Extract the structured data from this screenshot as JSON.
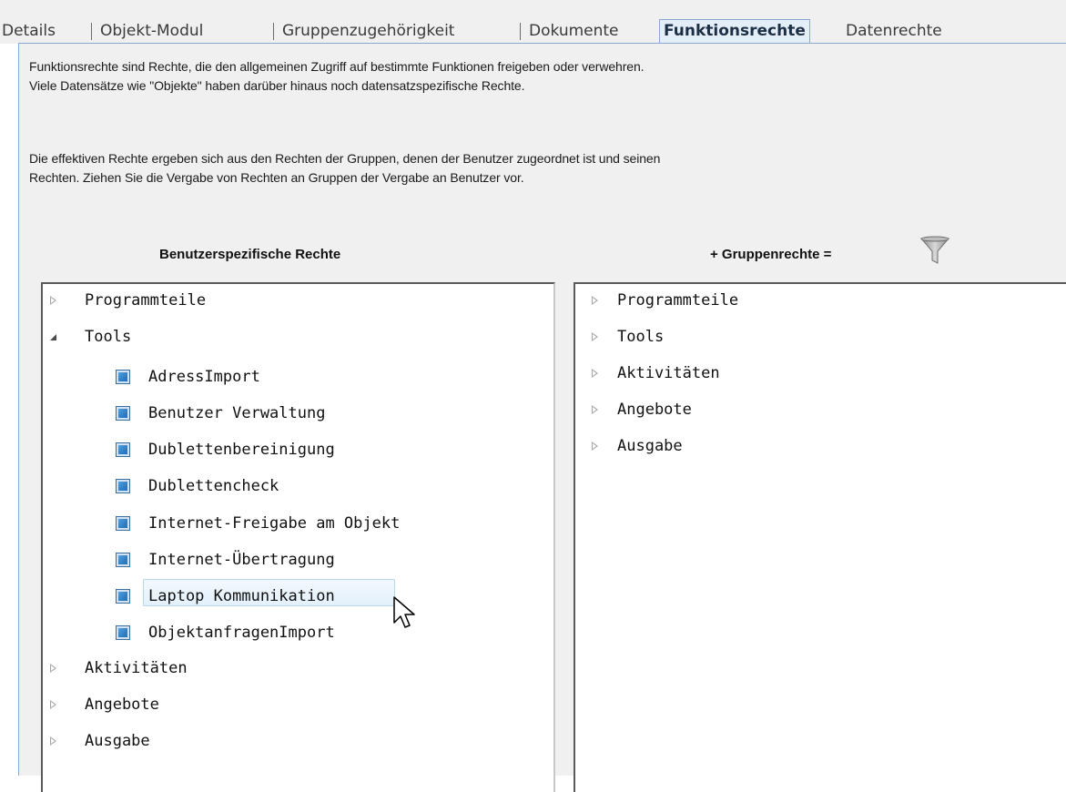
{
  "tabs": [
    {
      "label": "Details"
    },
    {
      "label": "Objekt-Modul"
    },
    {
      "label": "Gruppenzugehörigkeit"
    },
    {
      "label": "Dokumente"
    },
    {
      "label": "Funktionsrechte",
      "active": true
    },
    {
      "label": "Datenrechte"
    }
  ],
  "info": {
    "line1": "Funktionsrechte sind Rechte, die den allgemeinen Zugriff auf bestimmte Funktionen freigeben oder verwehren.",
    "line2": "Viele Datensätze wie \"Objekte\" haben darüber hinaus noch datensatzspezifische Rechte.",
    "line3": "Die effektiven Rechte ergeben sich aus den Rechten der Gruppen, denen der Benutzer zugeordnet ist und seinen",
    "line4": "Rechten. Ziehen Sie die Vergabe von Rechten an Gruppen der Vergabe an Benutzer vor."
  },
  "columns": {
    "user_rights": "Benutzerspezifische Rechte",
    "group_rights": "+ Gruppenrechte ="
  },
  "icons": {
    "filter": "funnel-icon",
    "expand": "triangle-right-icon",
    "collapse": "triangle-down-icon",
    "permission": "checkbox-filled-icon",
    "cursor": "mouse-pointer-icon"
  },
  "colors": {
    "accent": "#8aa8cf",
    "checkbox": "#2f7fc6",
    "selection": "#e3f0fb"
  },
  "user_tree": [
    {
      "label": "Programmteile",
      "expanded": false
    },
    {
      "label": "Tools",
      "expanded": true,
      "children": [
        {
          "label": "AdressImport"
        },
        {
          "label": "Benutzer Verwaltung"
        },
        {
          "label": "Dublettenbereinigung"
        },
        {
          "label": "Dublettencheck"
        },
        {
          "label": "Internet-Freigabe am Objekt"
        },
        {
          "label": "Internet-Übertragung"
        },
        {
          "label": "Laptop Kommunikation",
          "selected": true
        },
        {
          "label": "ObjektanfragenImport"
        }
      ]
    },
    {
      "label": "Aktivitäten",
      "expanded": false
    },
    {
      "label": "Angebote",
      "expanded": false
    },
    {
      "label": "Ausgabe",
      "expanded": false
    }
  ],
  "group_tree": [
    {
      "label": "Programmteile"
    },
    {
      "label": "Tools"
    },
    {
      "label": "Aktivitäten"
    },
    {
      "label": "Angebote"
    },
    {
      "label": "Ausgabe"
    }
  ]
}
